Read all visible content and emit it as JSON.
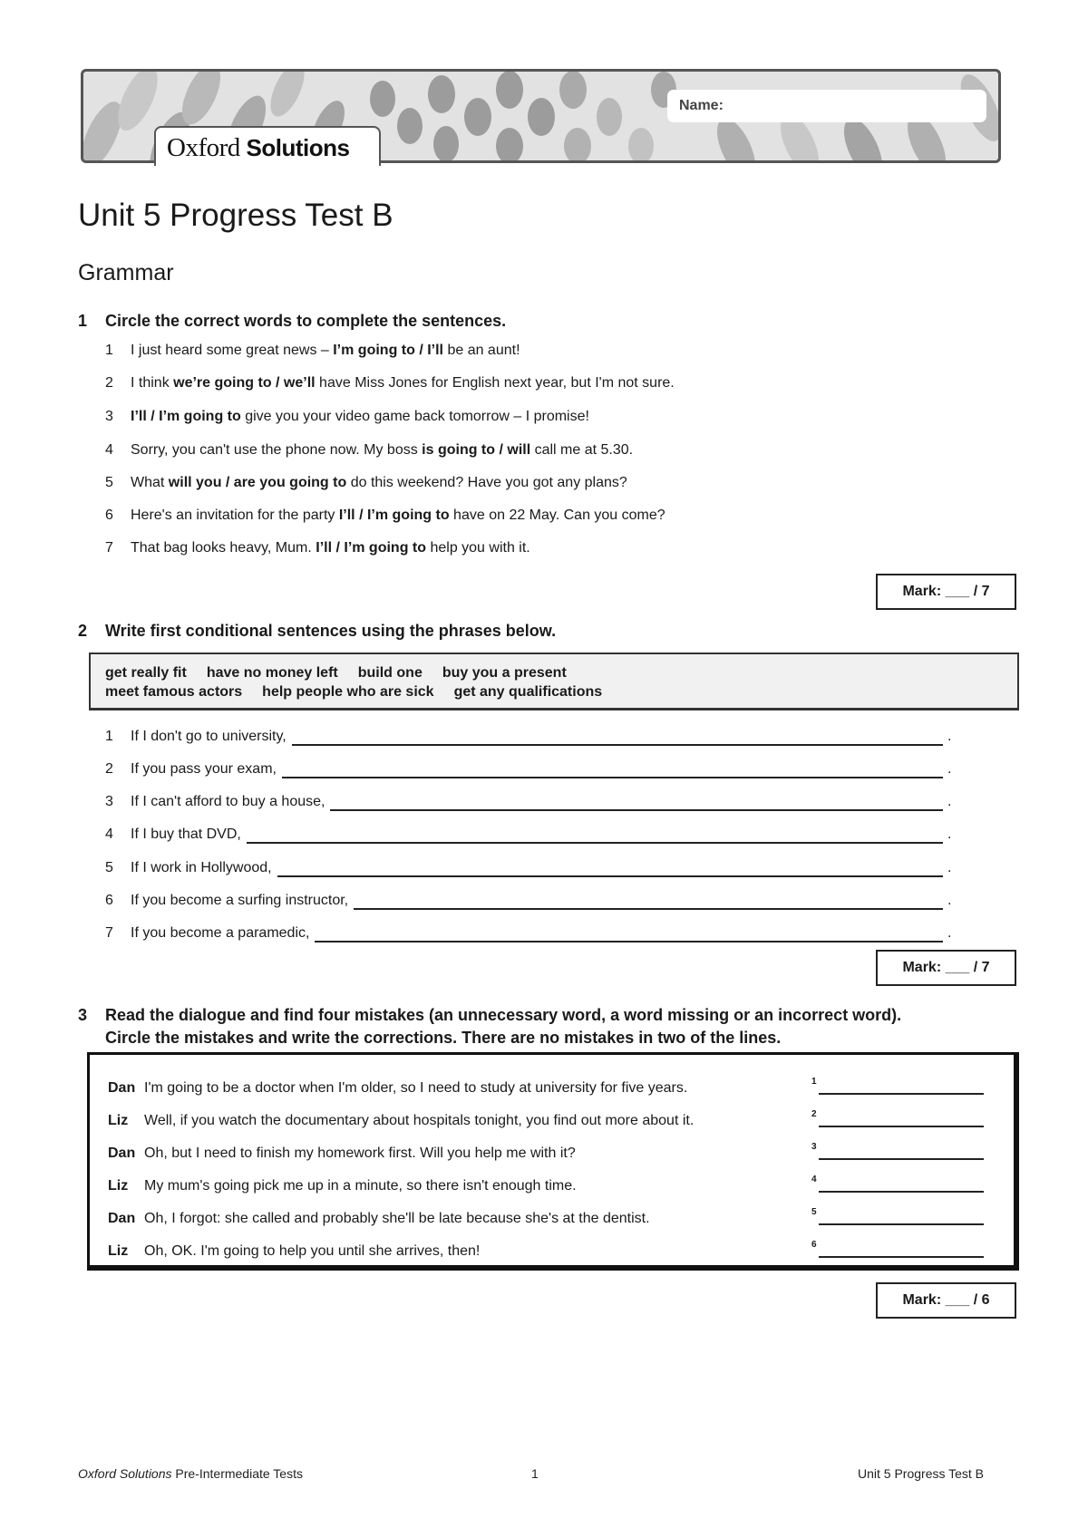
{
  "header": {
    "logo": {
      "part1": "Oxford",
      "part2": "Solutions"
    },
    "name_label": "Name:"
  },
  "title": "Unit 5 Progress Test B",
  "section_title": "Grammar",
  "exercises": [
    {
      "number": "1",
      "instruction": "Circle the correct words to complete the sentences.",
      "items": [
        {
          "n": "1",
          "parts": [
            {
              "t": "I just heard some great news – "
            },
            {
              "t": "I’m going to / I’ll",
              "b": true
            },
            {
              "t": " be an aunt!"
            }
          ]
        },
        {
          "n": "2",
          "parts": [
            {
              "t": "I think "
            },
            {
              "t": "we’re going to / we’ll",
              "b": true
            },
            {
              "t": " have Miss Jones for English next year, but I'm not sure."
            }
          ]
        },
        {
          "n": "3",
          "parts": [
            {
              "t": "I’ll / I’m going to",
              "b": true
            },
            {
              "t": " give you your video game back tomorrow – I promise!"
            }
          ]
        },
        {
          "n": "4",
          "parts": [
            {
              "t": "Sorry, you can't use the phone now. My boss "
            },
            {
              "t": "is going to / will",
              "b": true
            },
            {
              "t": " call me at 5.30."
            }
          ]
        },
        {
          "n": "5",
          "parts": [
            {
              "t": "What "
            },
            {
              "t": "will you / are you going to",
              "b": true
            },
            {
              "t": " do this weekend? Have you got any plans?"
            }
          ]
        },
        {
          "n": "6",
          "parts": [
            {
              "t": "Here's an invitation for the party "
            },
            {
              "t": "I’ll / I’m going to",
              "b": true
            },
            {
              "t": " have on 22 May. Can you come?"
            }
          ]
        },
        {
          "n": "7",
          "parts": [
            {
              "t": "That bag looks heavy, Mum. "
            },
            {
              "t": "I’ll / I’m going to",
              "b": true
            },
            {
              "t": " help you with it."
            }
          ]
        }
      ],
      "mark": "Mark: ___ / 7"
    },
    {
      "number": "2",
      "instruction": "Write first conditional sentences using the phrases below.",
      "phrases_row1": [
        "get really fit",
        "have no money left",
        "build one",
        "buy you a present"
      ],
      "phrases_row2": [
        "meet famous actors",
        "help people who are sick",
        "get any qualifications"
      ],
      "items": [
        {
          "n": "1",
          "text": "If I don't go to university,",
          "value": ""
        },
        {
          "n": "2",
          "text": "If you pass your exam,",
          "value": ""
        },
        {
          "n": "3",
          "text": "If I can't afford to buy a house,",
          "value": ""
        },
        {
          "n": "4",
          "text": "If I buy that DVD,",
          "value": ""
        },
        {
          "n": "5",
          "text": "If I work in Hollywood,",
          "value": ""
        },
        {
          "n": "6",
          "text": "If you become a surfing instructor,",
          "value": ""
        },
        {
          "n": "7",
          "text": "If you become a paramedic,",
          "value": ""
        }
      ],
      "end_punct": ".",
      "mark": "Mark: ___ / 7"
    },
    {
      "number": "3",
      "instruction_line1": "Read the dialogue and find four mistakes (an unnecessary word, a word missing or an incorrect word).",
      "instruction_line2": "Circle the mistakes and write the corrections. There are no mistakes in two of the lines.",
      "dialogue": [
        {
          "speaker": "Dan",
          "line": "I'm going to be a doctor when I'm older, so I need to study at university for five years.",
          "answer_num": "1"
        },
        {
          "speaker": "Liz",
          "line": "Well, if you watch the documentary about hospitals tonight, you find out more about it.",
          "answer_num": "2"
        },
        {
          "speaker": "Dan",
          "line": "Oh, but I need to finish my homework first. Will you help me with it?",
          "answer_num": "3"
        },
        {
          "speaker": "Liz",
          "line": "My mum's going pick me up in a minute, so there isn't enough time.",
          "answer_num": "4"
        },
        {
          "speaker": "Dan",
          "line": "Oh, I forgot: she called and probably she'll be late because she's at the dentist.",
          "answer_num": "5"
        },
        {
          "speaker": "Liz",
          "line": "Oh, OK. I'm going to help you until she arrives, then!",
          "answer_num": "6"
        }
      ],
      "mark": "Mark: ___ / 6"
    }
  ],
  "footer": {
    "left_italic": "Oxford Solutions",
    "left_rest": " Pre-Intermediate Tests",
    "page": "1",
    "right": "Unit 5 Progress Test B"
  }
}
